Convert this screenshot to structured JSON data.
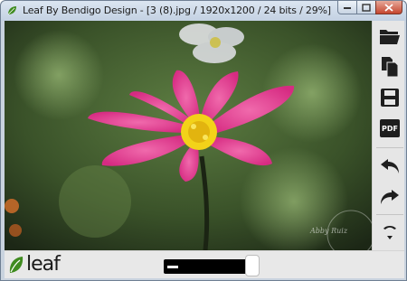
{
  "window": {
    "title": "Leaf By Bendigo Design - [3 (8).jpg / 1920x1200 / 24 bits / 29%]"
  },
  "photo": {
    "watermark": "Abby Ruiz",
    "colors": {
      "petal": "#e0338a",
      "petal_light": "#f56fb0",
      "center": "#f2d21a",
      "background_dark": "#2c3b22",
      "background_mid": "#4b6a36"
    }
  },
  "toolbar": {
    "tools": [
      {
        "name": "open-folder-icon",
        "label": "Open"
      },
      {
        "name": "copy-icon",
        "label": "Copy"
      },
      {
        "name": "save-icon",
        "label": "Save"
      },
      {
        "name": "pdf-icon",
        "label": "PDF"
      },
      {
        "name": "undo-icon",
        "label": "Undo"
      },
      {
        "name": "redo-icon",
        "label": "Redo"
      },
      {
        "name": "rotate-down-icon",
        "label": "More"
      }
    ],
    "pdf_label": "PDF"
  },
  "bottombar": {
    "logo_text": "leaf",
    "zoom_fraction": 0.29,
    "accent": "#3f8b1f"
  }
}
